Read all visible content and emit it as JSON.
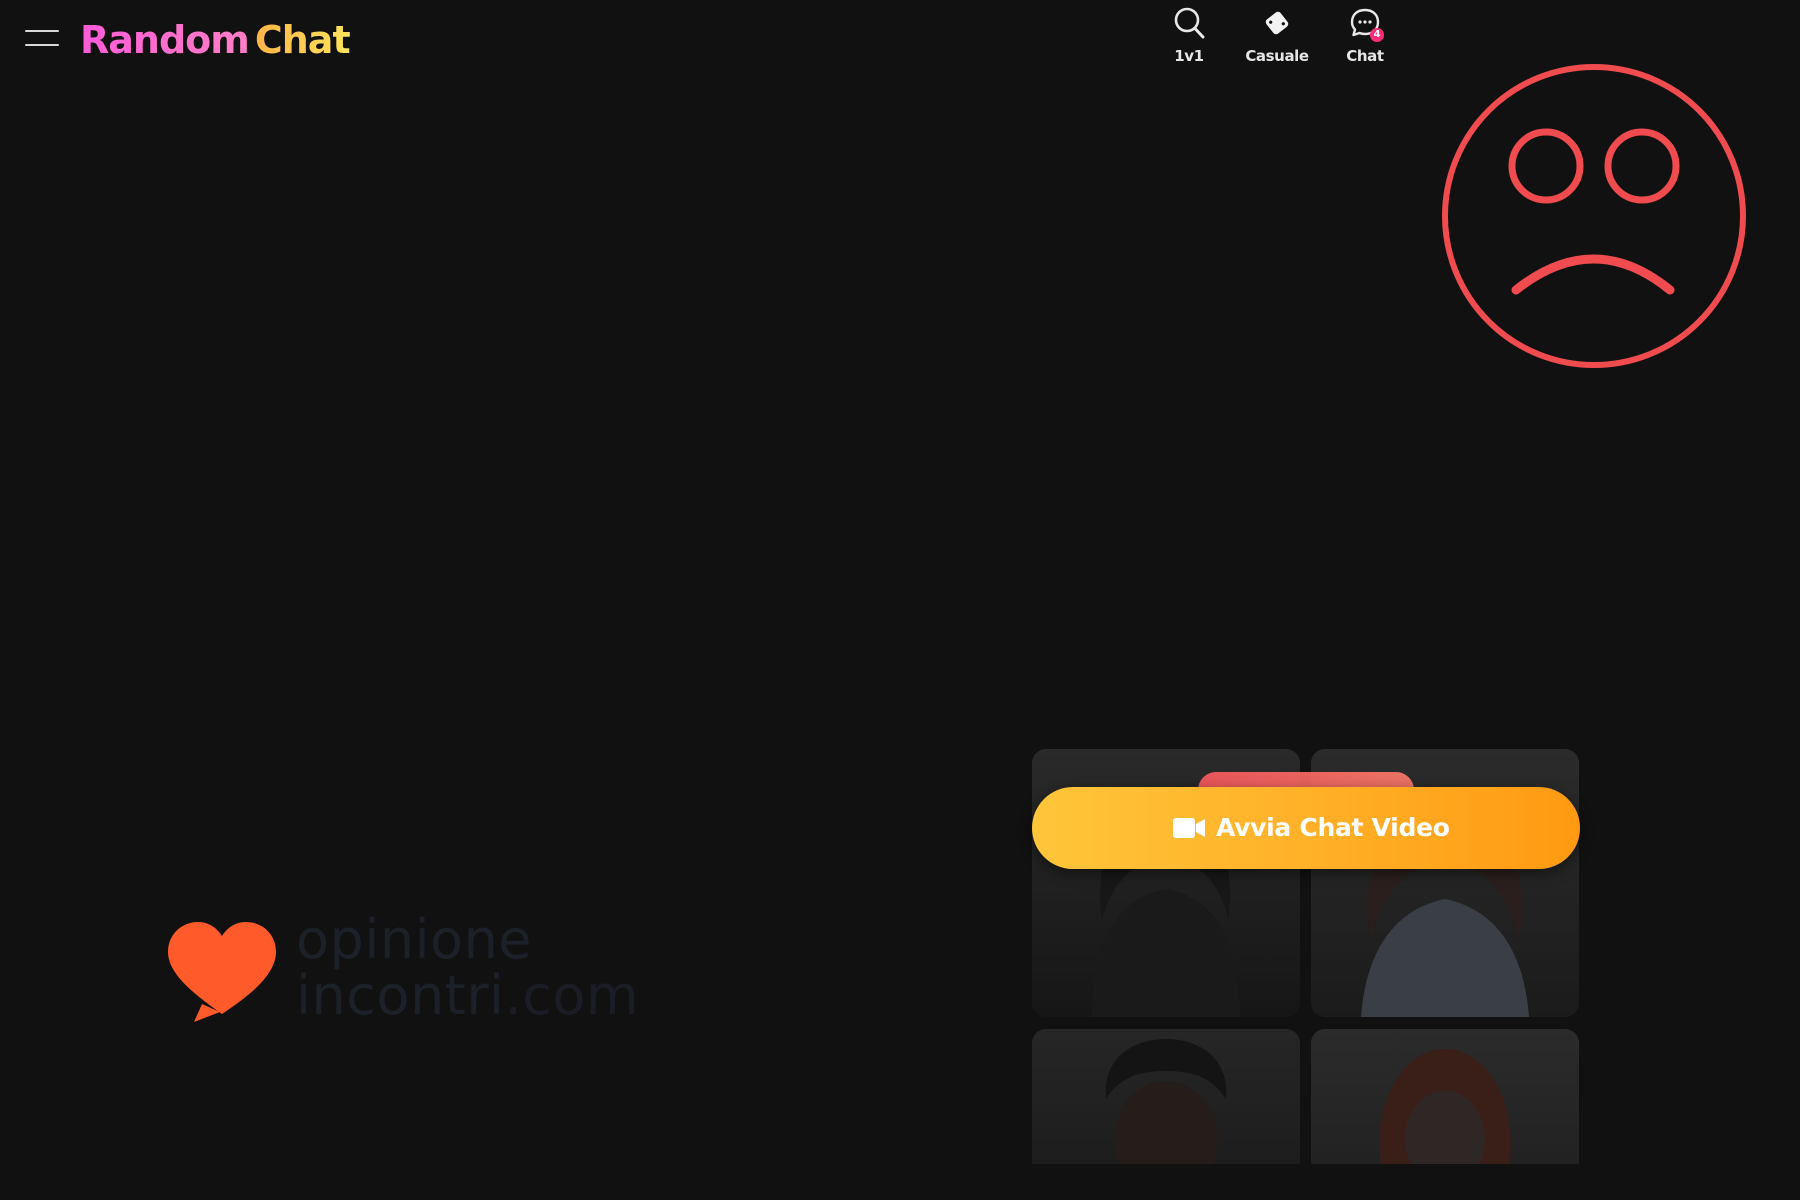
{
  "header": {
    "brand": {
      "word1": "Random",
      "word2": "Chat"
    },
    "nav": [
      {
        "label": "1v1",
        "icon": "search-icon"
      },
      {
        "label": "Casuale",
        "icon": "dice-icon"
      },
      {
        "label": "Chat",
        "icon": "chat-bubble-icon",
        "badge": "4"
      }
    ]
  },
  "overlay": {
    "icon": "sad-face-icon",
    "color": "#f04b4f"
  },
  "watermark": {
    "line1": "opinione",
    "line2_main": "incontri",
    "line2_domain": ".com",
    "heart_color": "#ff5a2a"
  },
  "cta": {
    "label": "Avvia Chat Video",
    "icon": "video-camera-icon"
  },
  "profiles": [
    {
      "name": "profile-photo-1"
    },
    {
      "name": "profile-photo-2"
    },
    {
      "name": "profile-photo-3"
    },
    {
      "name": "profile-photo-4"
    }
  ],
  "colors": {
    "background": "#111111",
    "accent_orange": "#ffb128",
    "badge": "#ff2d78"
  }
}
